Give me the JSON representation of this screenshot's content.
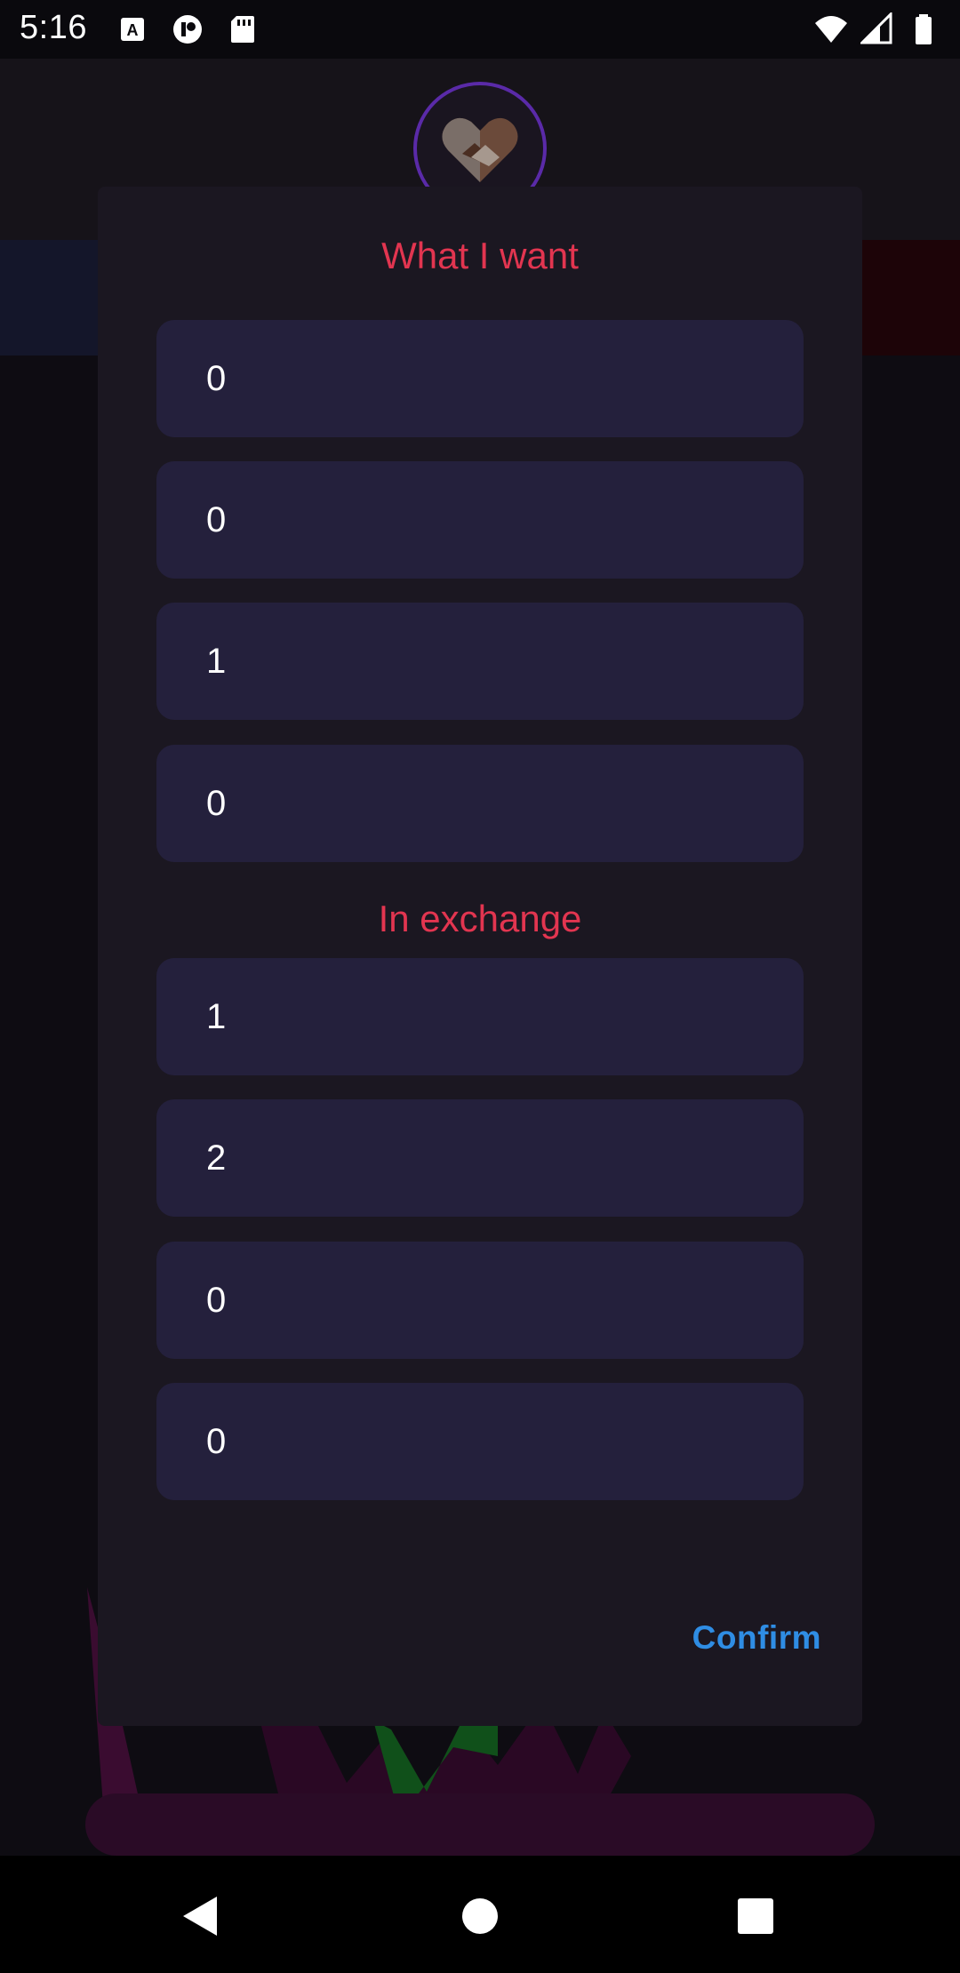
{
  "status_bar": {
    "time": "5:16",
    "left_icons": [
      "keyboard-a-icon",
      "notification-icon",
      "sd-card-icon"
    ],
    "right_icons": [
      "wifi-icon",
      "signal-icon",
      "battery-icon"
    ]
  },
  "dialog": {
    "want_title": "What I want",
    "want_values": [
      "0",
      "0",
      "1",
      "0"
    ],
    "exchange_title": "In exchange",
    "exchange_values": [
      "1",
      "2",
      "0",
      "0"
    ],
    "confirm_label": "Confirm"
  },
  "colors": {
    "title": "#e23550",
    "confirm": "#2f8de4",
    "field_bg": "#24203c",
    "dialog_bg": "#1b1721"
  },
  "nav_bar": {
    "icons": [
      "back-icon",
      "home-icon",
      "recents-icon"
    ]
  }
}
